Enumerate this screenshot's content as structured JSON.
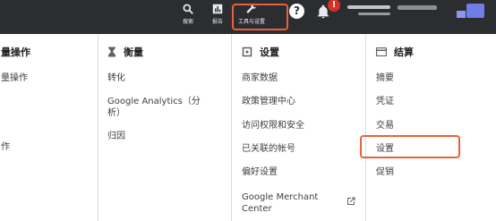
{
  "topbar": {
    "search_label": "搜索",
    "reports_label": "报告",
    "tools_label": "工具与设置",
    "help_label": "?",
    "notification_count": "!"
  },
  "columns": {
    "bulk": {
      "header": "量操作",
      "items": [
        "量操作",
        "作"
      ]
    },
    "measurement": {
      "header": "衡量",
      "items": [
        "转化",
        "Google Analytics（分析）",
        "归因"
      ]
    },
    "setup": {
      "header": "设置",
      "items": [
        "商家数据",
        "政策管理中心",
        "访问权限和安全",
        "已关联的帐号",
        "偏好设置",
        "Google Merchant Center"
      ]
    },
    "billing": {
      "header": "结算",
      "items": [
        "摘要",
        "凭证",
        "交易",
        "设置",
        "促销"
      ]
    }
  },
  "colors": {
    "topbar": "#2b2d30",
    "highlight": "#e8613d",
    "divider": "#dadce0"
  }
}
